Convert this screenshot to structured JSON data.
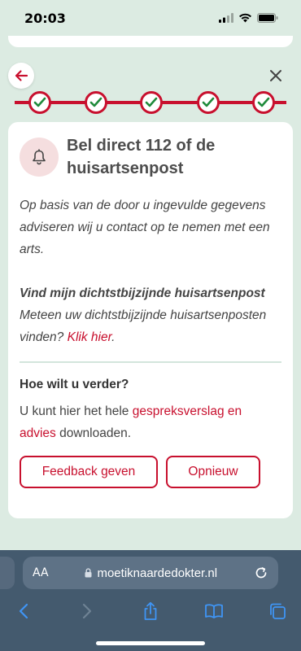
{
  "status_bar": {
    "time": "20:03"
  },
  "colors": {
    "accent": "#c8102e",
    "background": "#dcebe2",
    "browser_chrome": "#445a6e"
  },
  "nav": {
    "back_icon": "arrow-left-icon",
    "close_icon": "close-icon"
  },
  "progress": {
    "steps_total": 5,
    "steps_completed": 5
  },
  "advice": {
    "icon": "bell-icon",
    "title": "Bel direct 112 of de huisartsenpost",
    "intro": "Op basis van de door u ingevulde gegevens adviseren wij u contact op te nemen met een arts.",
    "nearest_heading": "Vind mijn dichtstbijzijnde huisartsenpost",
    "nearest_text": "Meteen uw dichtstbijzijnde huisartsenposten vinden?",
    "nearest_link": "Klik hier",
    "nearest_suffix": "."
  },
  "next_steps": {
    "heading": "Hoe wilt u verder?",
    "text_before": "U kunt hier het hele",
    "link": "gespreksverslag en advies",
    "text_after": "downloaden.",
    "feedback_label": "Feedback geven",
    "restart_label": "Opnieuw"
  },
  "browser": {
    "text_size_label": "AA",
    "url": "moetiknaardedokter.nl",
    "toolbar_icons": [
      "back-icon",
      "forward-icon",
      "share-icon",
      "bookmarks-icon",
      "tabs-icon"
    ]
  }
}
